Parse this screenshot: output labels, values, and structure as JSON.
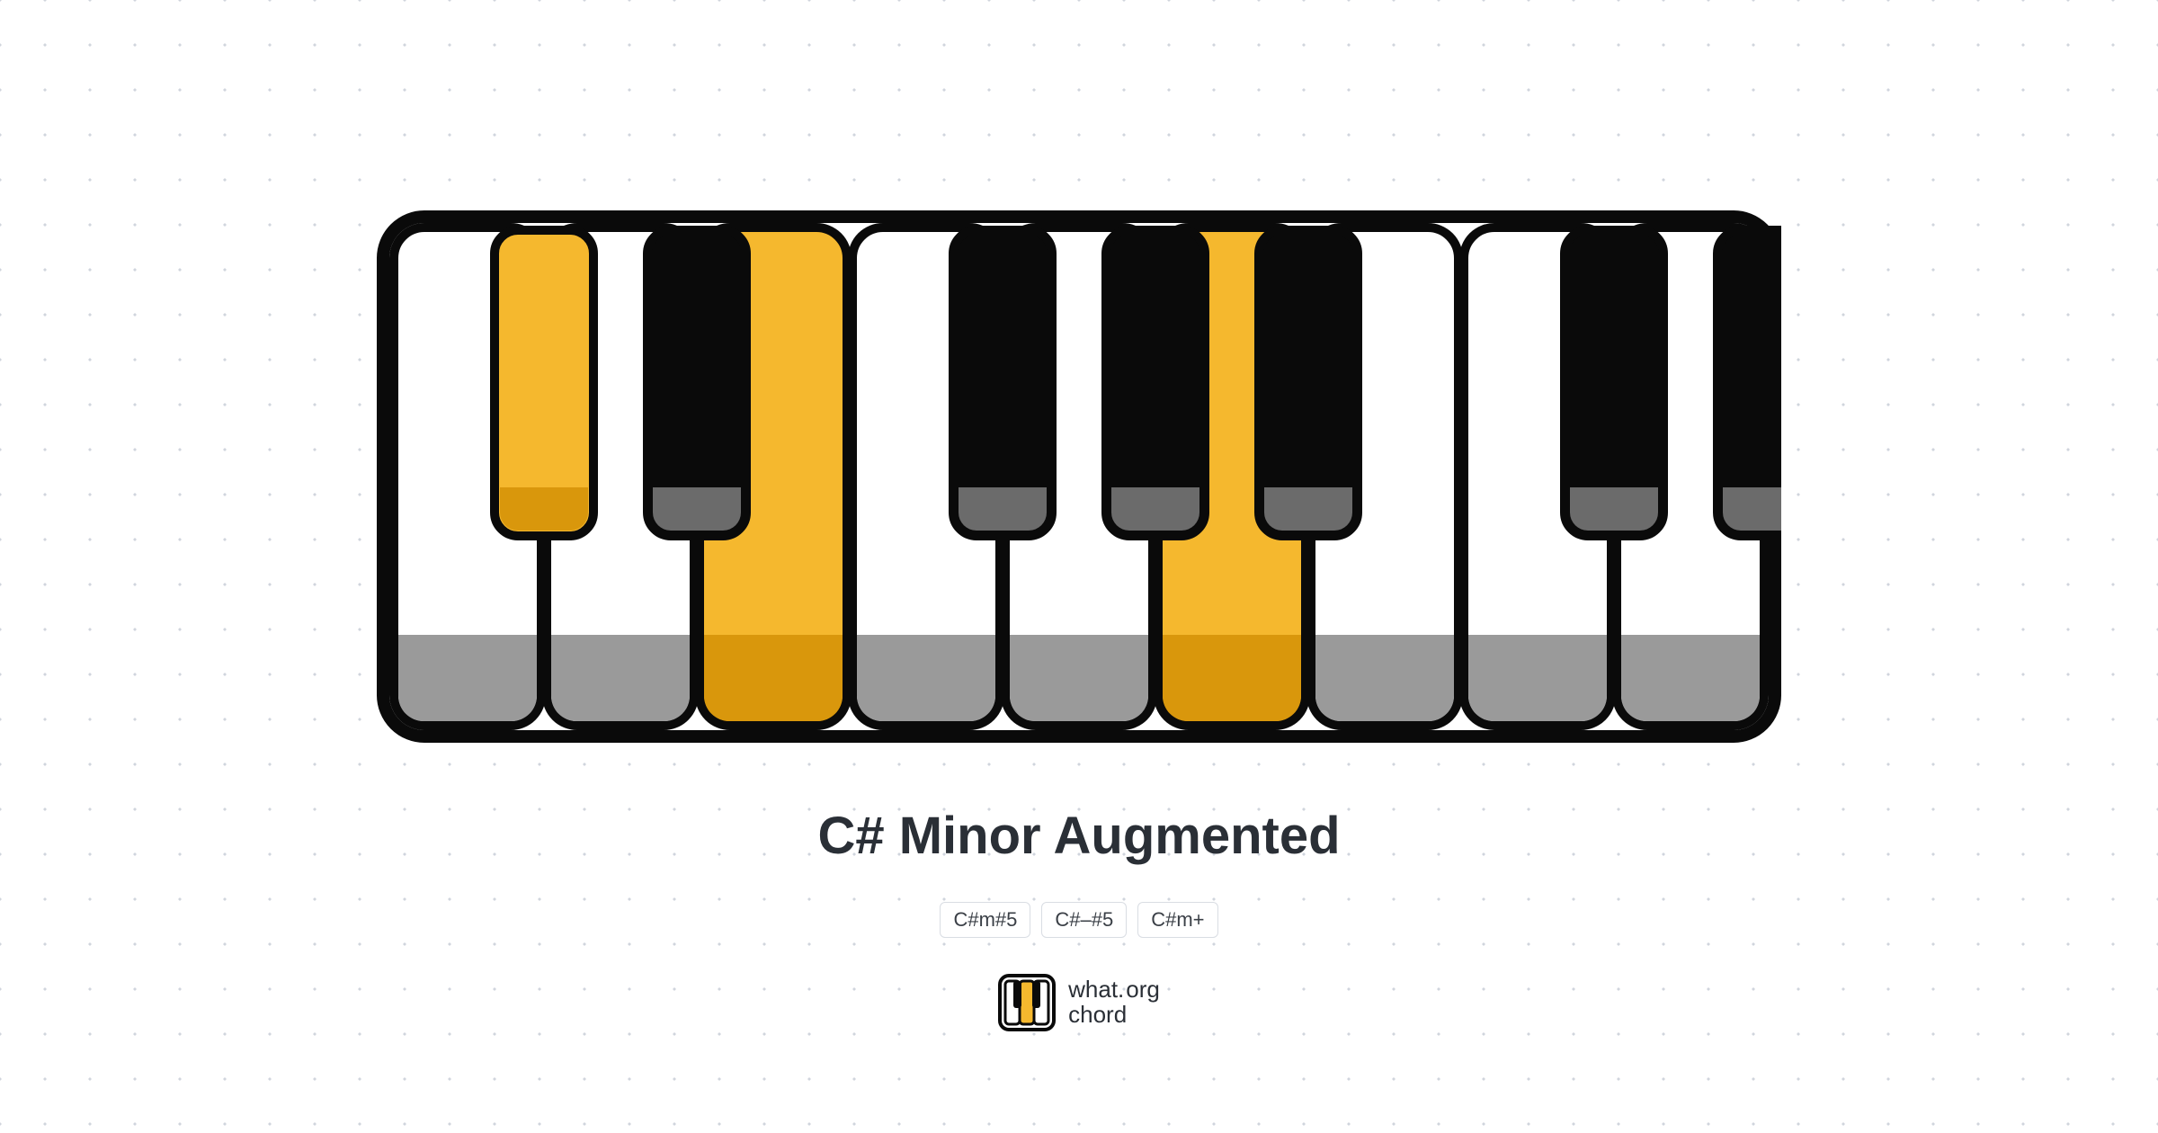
{
  "chord": {
    "title": "C# Minor Augmented",
    "aliases": [
      "C#m#5",
      "C#–#5",
      "C#m+"
    ]
  },
  "brand": {
    "line1": "what",
    "dot": ".",
    "org": "org",
    "line2": "chord"
  },
  "keyboard": {
    "whiteKeys": [
      {
        "note": "C",
        "highlighted": false
      },
      {
        "note": "D",
        "highlighted": false
      },
      {
        "note": "E",
        "highlighted": true
      },
      {
        "note": "F",
        "highlighted": false
      },
      {
        "note": "G",
        "highlighted": false
      },
      {
        "note": "A",
        "highlighted": true
      },
      {
        "note": "B",
        "highlighted": false
      },
      {
        "note": "C2",
        "highlighted": false
      },
      {
        "note": "D2",
        "highlighted": false
      }
    ],
    "blackKeys": [
      {
        "note": "C#",
        "afterWhiteIndex": 0,
        "highlighted": true
      },
      {
        "note": "D#",
        "afterWhiteIndex": 1,
        "highlighted": false
      },
      {
        "note": "F#",
        "afterWhiteIndex": 3,
        "highlighted": false
      },
      {
        "note": "G#",
        "afterWhiteIndex": 4,
        "highlighted": false
      },
      {
        "note": "A#",
        "afterWhiteIndex": 5,
        "highlighted": false
      },
      {
        "note": "C#2",
        "afterWhiteIndex": 7,
        "highlighted": false
      },
      {
        "note": "D#2",
        "afterWhiteIndex": 8,
        "highlighted": false
      }
    ],
    "colors": {
      "outline": "#0a0a0a",
      "whiteFill": "#ffffff",
      "whiteShadow": "#9a9a9a",
      "blackFill": "#0a0a0a",
      "blackShadow": "#6b6b6b",
      "hlWhiteFill": "#f5b82e",
      "hlWhiteShadow": "#d9970c",
      "hlBlackFill": "#f5b82e",
      "hlBlackShadow": "#d9970c"
    }
  }
}
